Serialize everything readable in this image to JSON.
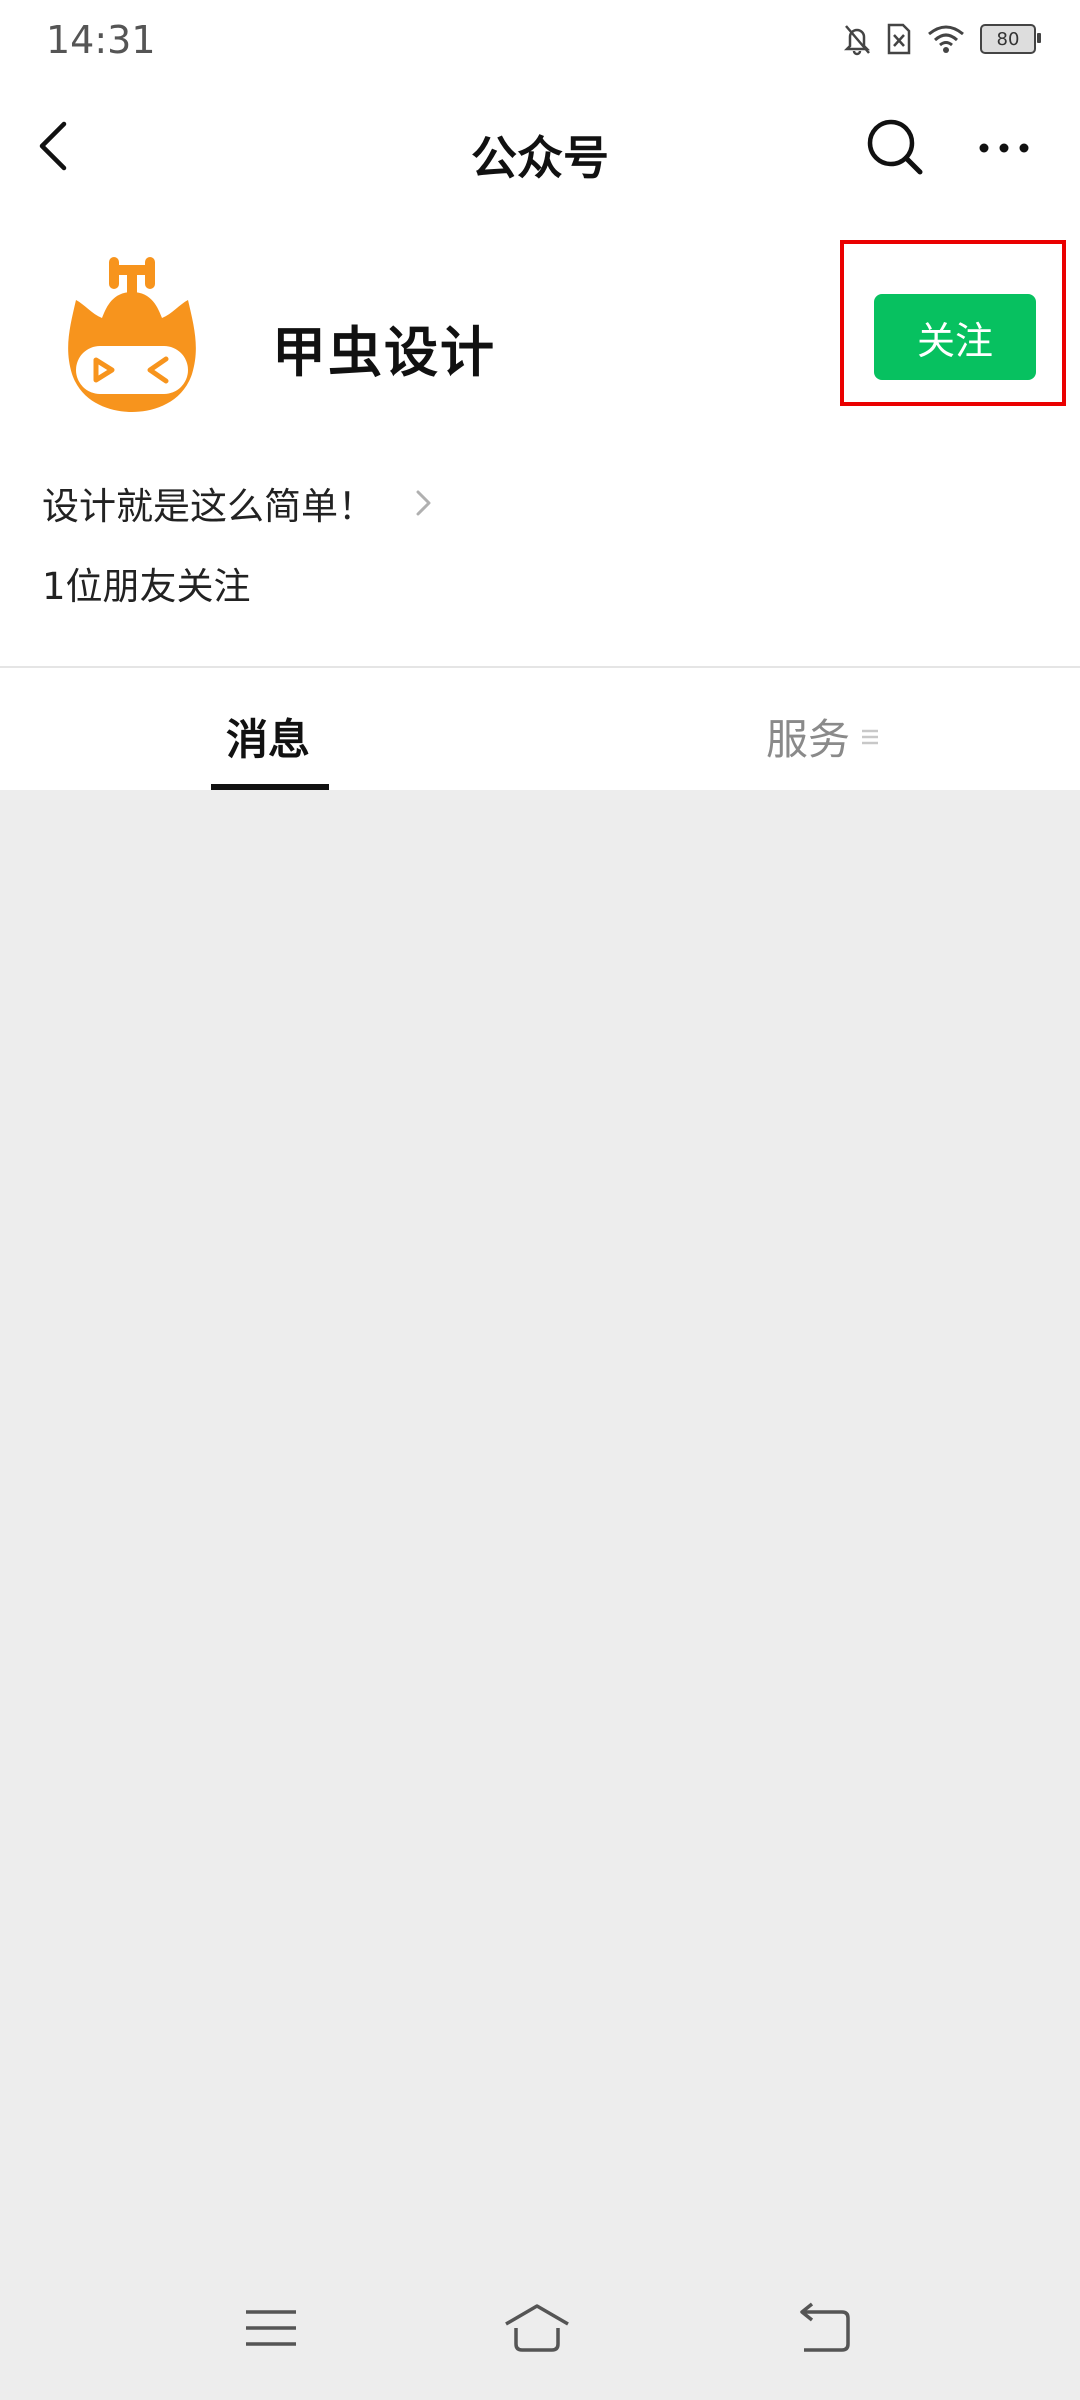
{
  "status_bar": {
    "time": "14:31",
    "battery": "80",
    "icons": [
      "mute-bell-icon",
      "no-sim-icon",
      "wifi-icon",
      "battery-icon"
    ]
  },
  "nav": {
    "title": "公众号",
    "back_icon": "chevron-left-icon",
    "search_icon": "search-icon",
    "more_icon": "more-dots-icon"
  },
  "profile": {
    "name": "甲虫设计",
    "follow_label": "关注",
    "signature": "设计就是这么简单！",
    "friends_following": "1位朋友关注",
    "avatar_color": "#f7941d"
  },
  "tabs": {
    "messages": "消息",
    "services": "服务"
  },
  "colors": {
    "accent_green": "#07c160",
    "highlight_red": "#ea0000"
  },
  "system_nav": {
    "icons": [
      "menu-icon",
      "home-icon",
      "back-icon"
    ]
  }
}
